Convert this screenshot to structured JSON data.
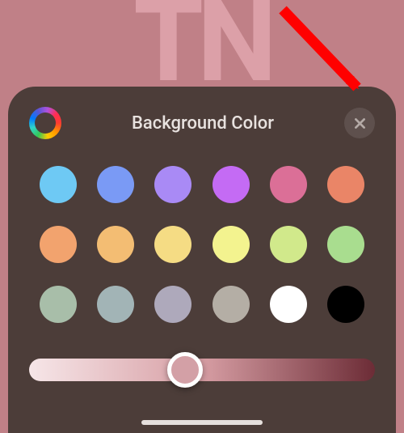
{
  "bg_letters": "TN",
  "sheet": {
    "title": "Background Color",
    "icons": {
      "color_wheel": "color-wheel-icon",
      "close": "close-icon"
    },
    "swatches": [
      "#6ec9f4",
      "#7a9af5",
      "#a98af5",
      "#c46bf4",
      "#db6f97",
      "#ea8567",
      "#f2a36e",
      "#f3bd73",
      "#f5dc84",
      "#f3f38f",
      "#d1e98b",
      "#a9dd8f",
      "#a8bea9",
      "#a2b4b6",
      "#aea9bb",
      "#b4aea5",
      "#ffffff",
      "#000000"
    ],
    "slider": {
      "gradient_from": "#f6e6e8",
      "gradient_mid": "#d79ea4",
      "gradient_to": "#6c2c36",
      "value": 0.45,
      "thumb_color": "#d3a0a6"
    }
  },
  "annotation": {
    "arrow_color": "#ff0000",
    "arrow_target": "close-button"
  }
}
